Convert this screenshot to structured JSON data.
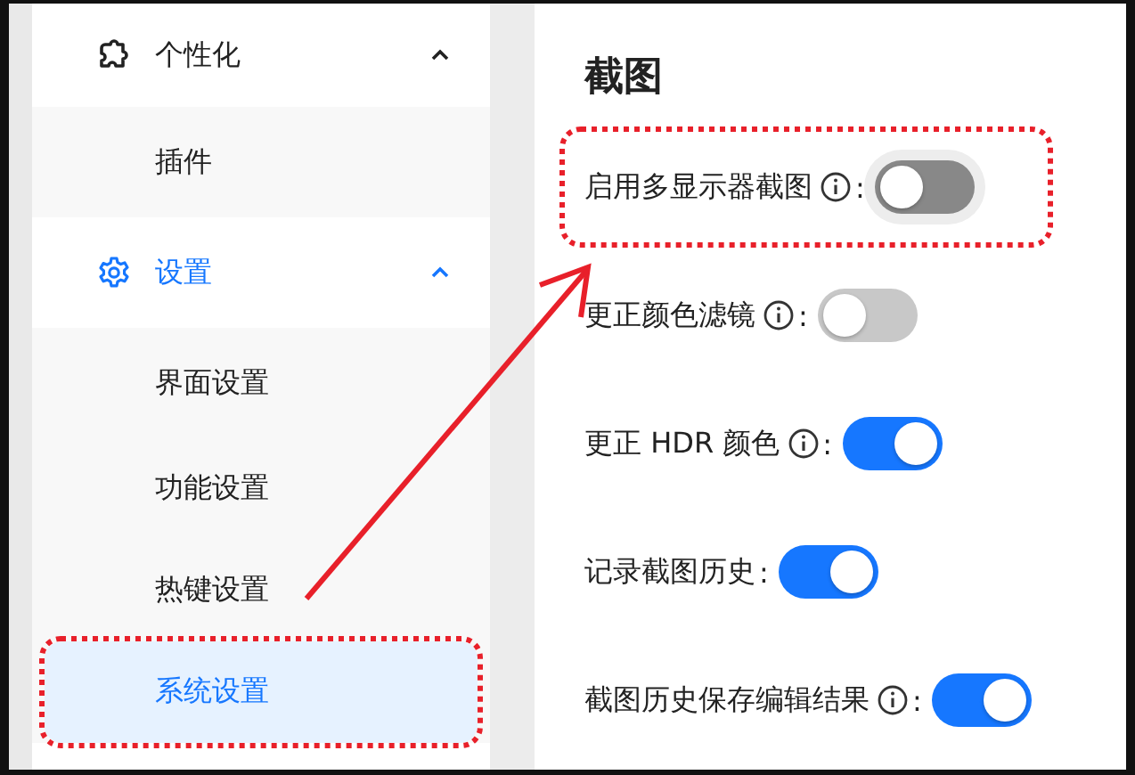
{
  "sidebar": {
    "items": [
      {
        "label": "个性化",
        "expanded": true,
        "selected": false,
        "children": [
          {
            "label": "插件",
            "selected": false,
            "highlighted": false
          }
        ]
      },
      {
        "label": "设置",
        "expanded": true,
        "selected": true,
        "children": [
          {
            "label": "界面设置",
            "selected": false,
            "highlighted": false
          },
          {
            "label": "功能设置",
            "selected": false,
            "highlighted": false
          },
          {
            "label": "热键设置",
            "selected": false,
            "highlighted": false
          },
          {
            "label": "系统设置",
            "selected": true,
            "highlighted": true
          }
        ]
      }
    ]
  },
  "content": {
    "heading": "截图",
    "settings": [
      {
        "label": "启用多显示器截图",
        "info": true,
        "separator": ":",
        "on": false,
        "hovered": true,
        "highlighted": true
      },
      {
        "label": "更正颜色滤镜",
        "info": true,
        "separator": ":",
        "on": false,
        "hovered": false,
        "highlighted": false
      },
      {
        "label": "更正 HDR 颜色",
        "info": true,
        "separator": ":",
        "on": true,
        "hovered": false,
        "highlighted": false
      },
      {
        "label": "记录截图历史",
        "info": false,
        "separator": ":",
        "on": true,
        "hovered": false,
        "highlighted": false
      },
      {
        "label": "截图历史保存编辑结果",
        "info": true,
        "separator": ":",
        "on": true,
        "hovered": false,
        "highlighted": false
      }
    ]
  },
  "annotations": [
    {
      "kind": "arrow"
    }
  ]
}
